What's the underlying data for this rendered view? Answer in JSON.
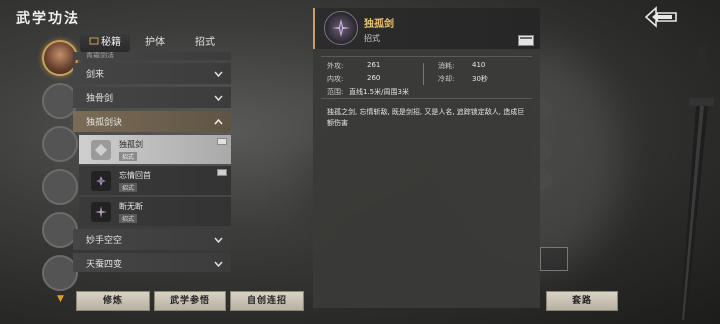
{
  "header": {
    "title": "武学功法",
    "back_icon": "back-arrow-icon"
  },
  "tabs": [
    {
      "label": "秘籍",
      "active": true,
      "icon": "scroll-icon"
    },
    {
      "label": "护体",
      "active": false
    },
    {
      "label": "招式",
      "active": false
    }
  ],
  "list": {
    "partial_label": "青霜剑法",
    "categories": [
      {
        "label": "剑来",
        "expanded": false
      },
      {
        "label": "独骨剑",
        "expanded": false
      },
      {
        "label": "独孤剑诀",
        "expanded": true
      }
    ],
    "subitems": [
      {
        "name": "独孤剑",
        "tag": "招式",
        "selected": true
      },
      {
        "name": "忘情回首",
        "tag": "招式",
        "selected": false
      },
      {
        "name": "断无断",
        "tag": "招式",
        "selected": false
      }
    ],
    "more_categories": [
      {
        "label": "妙手空空",
        "expanded": false
      },
      {
        "label": "天蚕四变",
        "expanded": false
      }
    ]
  },
  "detail": {
    "name": "独孤剑",
    "type": "招式",
    "stats": {
      "outer_attack_label": "外攻:",
      "outer_attack": "261",
      "consume_label": "消耗:",
      "consume": "410",
      "inner_attack_label": "内攻:",
      "inner_attack": "260",
      "cooldown_label": "冷却:",
      "cooldown": "30秒",
      "range_label": "范围:",
      "range": "直线1.5米/周围3米"
    },
    "description": "独孤之剑, 忘情斩敌, 既是剑招, 又是人名, 追踪锁定敌人, 造成巨额伤害"
  },
  "buttons": {
    "practice": "修炼",
    "insight": "武学参悟",
    "combo": "自创连招",
    "routine": "套路"
  },
  "colors": {
    "accent_gold": "#c9a05a",
    "skill_name": "#e8c070"
  }
}
